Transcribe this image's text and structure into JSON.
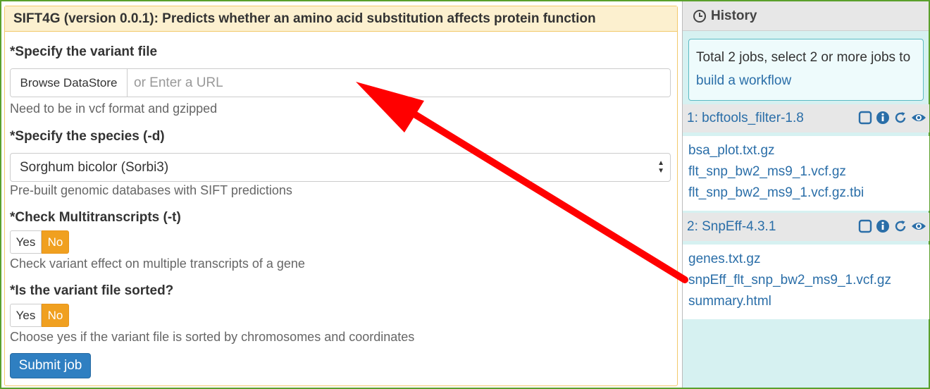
{
  "tool": {
    "heading": "SIFT4G (version 0.0.1): Predicts whether an amino acid substitution affects protein function",
    "variant_file": {
      "label": "*Specify the variant file",
      "browse_label": "Browse DataStore",
      "url_placeholder": "or Enter a URL",
      "help": "Need to be in vcf format and gzipped"
    },
    "species": {
      "label": "*Specify the species (-d)",
      "selected": "Sorghum bicolor (Sorbi3)",
      "help": "Pre-built genomic databases with SIFT predictions"
    },
    "multitranscripts": {
      "label": "*Check Multitranscripts (-t)",
      "yes": "Yes",
      "no": "No",
      "selected": "No",
      "help": "Check variant effect on multiple transcripts of a gene"
    },
    "sorted": {
      "label": "*Is the variant file sorted?",
      "yes": "Yes",
      "no": "No",
      "selected": "No",
      "help": "Choose yes if the variant file is sorted by chromosomes and coordinates"
    },
    "submit_label": "Submit job"
  },
  "history": {
    "title": "History",
    "info_text": "Total 2 jobs, select 2 or more jobs to",
    "info_link": "build a workflow",
    "jobs": [
      {
        "title": "1: bcftools_filter-1.8",
        "files": [
          "bsa_plot.txt.gz",
          "flt_snp_bw2_ms9_1.vcf.gz",
          "flt_snp_bw2_ms9_1.vcf.gz.tbi"
        ]
      },
      {
        "title": "2: SnpEff-4.3.1",
        "files": [
          "genes.txt.gz",
          "snpEff_flt_snp_bw2_ms9_1.vcf.gz",
          "summary.html"
        ]
      }
    ],
    "job_icons": [
      "checkbox-icon",
      "info-icon",
      "refresh-icon",
      "eye-icon"
    ]
  },
  "colors": {
    "frame_border": "#5aa02c",
    "accent_link": "#2a6ea8",
    "toggle_selected": "#f0a020",
    "submit_button": "#2f7fc1",
    "annotation_arrow": "#ff0000",
    "history_background": "#d6f1f1"
  },
  "annotation": {
    "type": "red-arrow",
    "from": "history.jobs.1.files.1",
    "to": "tool.variant_file.url_input"
  }
}
